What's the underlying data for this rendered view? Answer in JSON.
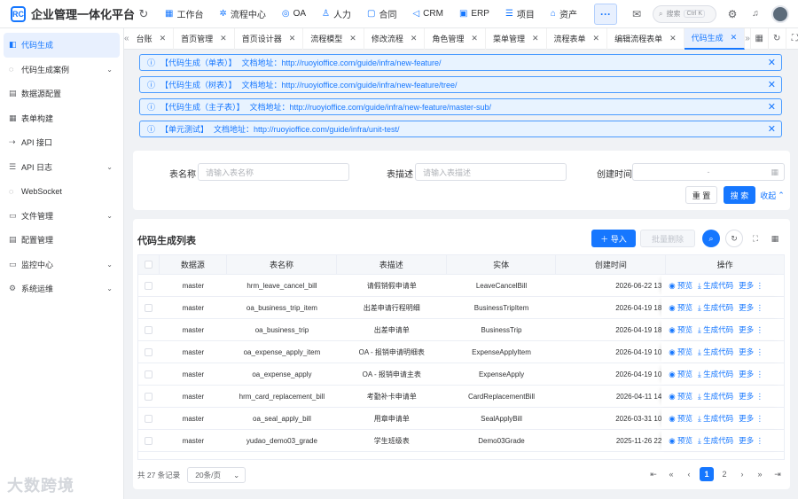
{
  "app": {
    "logo_mark": "RC",
    "title": "企业管理一体化平台"
  },
  "icons": {
    "refresh": "↻",
    "more": "···",
    "chat": "✉",
    "search": "⌕",
    "settings": "⚙",
    "bell": "🔔",
    "close": "✕",
    "expand": "⌄",
    "info": "ⓘ",
    "calendar": "▦",
    "left": "«",
    "right": "»"
  },
  "topnav": [
    {
      "label": "工作台",
      "icon": "▦"
    },
    {
      "label": "流程中心",
      "icon": "✲"
    },
    {
      "label": "OA",
      "icon": "◎"
    },
    {
      "label": "人力",
      "icon": "♙"
    },
    {
      "label": "合同",
      "icon": "▢"
    },
    {
      "label": "CRM",
      "icon": "◁"
    },
    {
      "label": "ERP",
      "icon": "▣"
    },
    {
      "label": "项目",
      "icon": "☰"
    },
    {
      "label": "资产",
      "icon": "⌂"
    }
  ],
  "search": {
    "placeholder": "搜索",
    "shortcut": "Ctrl K"
  },
  "sidebar": [
    {
      "label": "代码生成",
      "icon": "◧",
      "active": true,
      "chevron": false
    },
    {
      "label": "代码生成案例",
      "icon": "◌",
      "active": false,
      "chevron": true
    },
    {
      "label": "数据源配置",
      "icon": "▤",
      "active": false,
      "chevron": false
    },
    {
      "label": "表单构建",
      "icon": "▦",
      "active": false,
      "chevron": false
    },
    {
      "label": "API 接口",
      "icon": "⇢",
      "active": false,
      "chevron": false
    },
    {
      "label": "API 日志",
      "icon": "☰",
      "active": false,
      "chevron": true
    },
    {
      "label": "WebSocket",
      "icon": "◌",
      "active": false,
      "chevron": false
    },
    {
      "label": "文件管理",
      "icon": "▭",
      "active": false,
      "chevron": true
    },
    {
      "label": "配置管理",
      "icon": "▤",
      "active": false,
      "chevron": false
    },
    {
      "label": "监控中心",
      "icon": "▭",
      "active": false,
      "chevron": true
    },
    {
      "label": "系统运维",
      "icon": "⚙",
      "active": false,
      "chevron": true
    }
  ],
  "tabs": [
    "台账",
    "首页管理",
    "首页设计器",
    "流程模型",
    "修改流程",
    "角色管理",
    "菜单管理",
    "流程表单",
    "编辑流程表单",
    "代码生成"
  ],
  "active_tab": "代码生成",
  "alerts": [
    {
      "tag": "【代码生成（单表）】",
      "text": "文档地址：http://ruoyioffice.com/guide/infra/new-feature/"
    },
    {
      "tag": "【代码生成（树表）】",
      "text": "文档地址：http://ruoyioffice.com/guide/infra/new-feature/tree/"
    },
    {
      "tag": "【代码生成（主子表）】",
      "text": "文档地址：http://ruoyioffice.com/guide/infra/new-feature/master-sub/"
    },
    {
      "tag": "【单元测试】",
      "text": "文档地址：http://ruoyioffice.com/guide/infra/unit-test/"
    }
  ],
  "filter": {
    "table_name_label": "表名称",
    "table_name_placeholder": "请输入表名称",
    "table_desc_label": "表描述",
    "table_desc_placeholder": "请输入表描述",
    "created_label": "创建时间",
    "date_sep": "-",
    "reset": "重 置",
    "search": "搜 索",
    "collapse": "收起"
  },
  "panel": {
    "title": "代码生成列表",
    "import": "＋ 导入",
    "batch_delete": "批量删除"
  },
  "table": {
    "columns": [
      "数据源",
      "表名称",
      "表描述",
      "实体",
      "创建时间",
      "操作"
    ],
    "rows": [
      {
        "ds": "master",
        "name": "hrm_leave_cancel_bill",
        "desc": "请假销假申请单",
        "entity": "LeaveCancelBill",
        "time": "2026-06-22 13"
      },
      {
        "ds": "master",
        "name": "oa_business_trip_item",
        "desc": "出差申请行程明细",
        "entity": "BusinessTripItem",
        "time": "2026-04-19 18"
      },
      {
        "ds": "master",
        "name": "oa_business_trip",
        "desc": "出差申请单",
        "entity": "BusinessTrip",
        "time": "2026-04-19 18"
      },
      {
        "ds": "master",
        "name": "oa_expense_apply_item",
        "desc": "OA - 报销申请明细表",
        "entity": "ExpenseApplyItem",
        "time": "2026-04-19 10"
      },
      {
        "ds": "master",
        "name": "oa_expense_apply",
        "desc": "OA - 报销申请主表",
        "entity": "ExpenseApply",
        "time": "2026-04-19 10"
      },
      {
        "ds": "master",
        "name": "hrm_card_replacement_bill",
        "desc": "考勤补卡申请单",
        "entity": "CardReplacementBill",
        "time": "2026-04-11 14"
      },
      {
        "ds": "master",
        "name": "oa_seal_apply_bill",
        "desc": "用章申请单",
        "entity": "SealApplyBill",
        "time": "2026-03-31 10"
      },
      {
        "ds": "master",
        "name": "yudao_demo03_grade",
        "desc": "学生班级表",
        "entity": "Demo03Grade",
        "time": "2025-11-26 22"
      }
    ],
    "ops": {
      "preview": "◉ 预览",
      "generate": "⤓ 生成代码",
      "more": "更多 ⋮"
    }
  },
  "footer": {
    "total": "共 27 条记录",
    "page_size": "20条/页",
    "pages": [
      "1",
      "2"
    ],
    "current": "1"
  },
  "watermark": "大数跨境"
}
